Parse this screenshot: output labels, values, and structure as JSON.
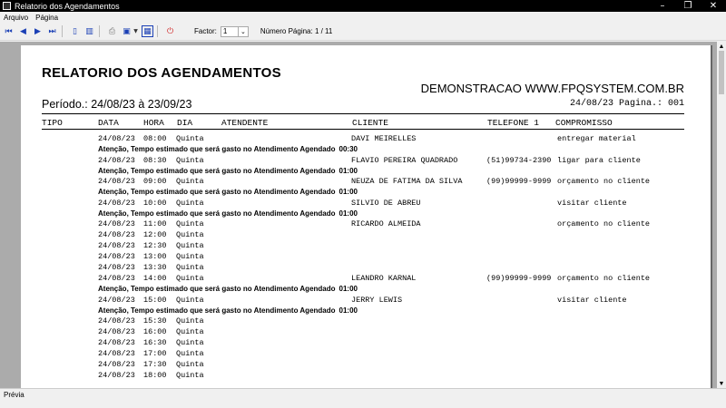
{
  "window": {
    "title": "Relatorio dos Agendamentos",
    "minimize": "–",
    "maximize": "❐",
    "close": "✕"
  },
  "menu": [
    "Arquivo",
    "Página"
  ],
  "toolbar": {
    "factor_label": "Factor:",
    "factor_value": "1",
    "page_info": "Número Página: 1 / 11"
  },
  "status": "Prévia",
  "report": {
    "title": "RELATORIO DOS AGENDAMENTOS",
    "company": "DEMONSTRACAO WWW.FPQSYSTEM.COM.BR",
    "periodo": "Período.: 24/08/23 à 23/09/23",
    "date_page": "24/08/23  Pagina.: 001",
    "headers": [
      "TIPO",
      "DATA",
      "HORA",
      "DIA",
      "ATENDENTE",
      "CLIENTE",
      "TELEFONE 1",
      "COMPROMISSO"
    ],
    "note_text": "Atenção, Tempo estimado que será gasto no Atendimento Agendado",
    "rows": [
      {
        "data": "24/08/23",
        "hora": "08:00",
        "dia": "Quinta",
        "cliente": "DAVI MEIRELLES",
        "telefone": "",
        "compromisso": "entregar material",
        "tempo": "00:30"
      },
      {
        "data": "24/08/23",
        "hora": "08:30",
        "dia": "Quinta",
        "cliente": "FLAVIO PEREIRA QUADRADO",
        "telefone": "(51)99734-2390",
        "compromisso": "ligar para cliente",
        "tempo": "01:00"
      },
      {
        "data": "24/08/23",
        "hora": "09:00",
        "dia": "Quinta",
        "cliente": "NEUZA DE FATIMA DA SILVA",
        "telefone": "(99)99999-9999",
        "compromisso": "orçamento no cliente",
        "tempo": "01:00"
      },
      {
        "data": "24/08/23",
        "hora": "10:00",
        "dia": "Quinta",
        "cliente": "SILVIO DE ABREU",
        "telefone": "",
        "compromisso": "visitar cliente",
        "tempo": "01:00"
      },
      {
        "data": "24/08/23",
        "hora": "11:00",
        "dia": "Quinta",
        "cliente": "RICARDO ALMEIDA",
        "telefone": "",
        "compromisso": "orçamento no cliente",
        "tempo": ""
      },
      {
        "data": "24/08/23",
        "hora": "12:00",
        "dia": "Quinta",
        "cliente": "",
        "telefone": "",
        "compromisso": "",
        "tempo": ""
      },
      {
        "data": "24/08/23",
        "hora": "12:30",
        "dia": "Quinta",
        "cliente": "",
        "telefone": "",
        "compromisso": "",
        "tempo": ""
      },
      {
        "data": "24/08/23",
        "hora": "13:00",
        "dia": "Quinta",
        "cliente": "",
        "telefone": "",
        "compromisso": "",
        "tempo": ""
      },
      {
        "data": "24/08/23",
        "hora": "13:30",
        "dia": "Quinta",
        "cliente": "",
        "telefone": "",
        "compromisso": "",
        "tempo": ""
      },
      {
        "data": "24/08/23",
        "hora": "14:00",
        "dia": "Quinta",
        "cliente": "LEANDRO KARNAL",
        "telefone": "(99)99999-9999",
        "compromisso": "orçamento no cliente",
        "tempo": "01:00"
      },
      {
        "data": "24/08/23",
        "hora": "15:00",
        "dia": "Quinta",
        "cliente": "JERRY LEWIS",
        "telefone": "",
        "compromisso": "visitar cliente",
        "tempo": "01:00"
      },
      {
        "data": "24/08/23",
        "hora": "15:30",
        "dia": "Quinta",
        "cliente": "",
        "telefone": "",
        "compromisso": "",
        "tempo": ""
      },
      {
        "data": "24/08/23",
        "hora": "16:00",
        "dia": "Quinta",
        "cliente": "",
        "telefone": "",
        "compromisso": "",
        "tempo": ""
      },
      {
        "data": "24/08/23",
        "hora": "16:30",
        "dia": "Quinta",
        "cliente": "",
        "telefone": "",
        "compromisso": "",
        "tempo": ""
      },
      {
        "data": "24/08/23",
        "hora": "17:00",
        "dia": "Quinta",
        "cliente": "",
        "telefone": "",
        "compromisso": "",
        "tempo": ""
      },
      {
        "data": "24/08/23",
        "hora": "17:30",
        "dia": "Quinta",
        "cliente": "",
        "telefone": "",
        "compromisso": "",
        "tempo": ""
      },
      {
        "data": "24/08/23",
        "hora": "18:00",
        "dia": "Quinta",
        "cliente": "",
        "telefone": "",
        "compromisso": "",
        "tempo": ""
      }
    ]
  }
}
